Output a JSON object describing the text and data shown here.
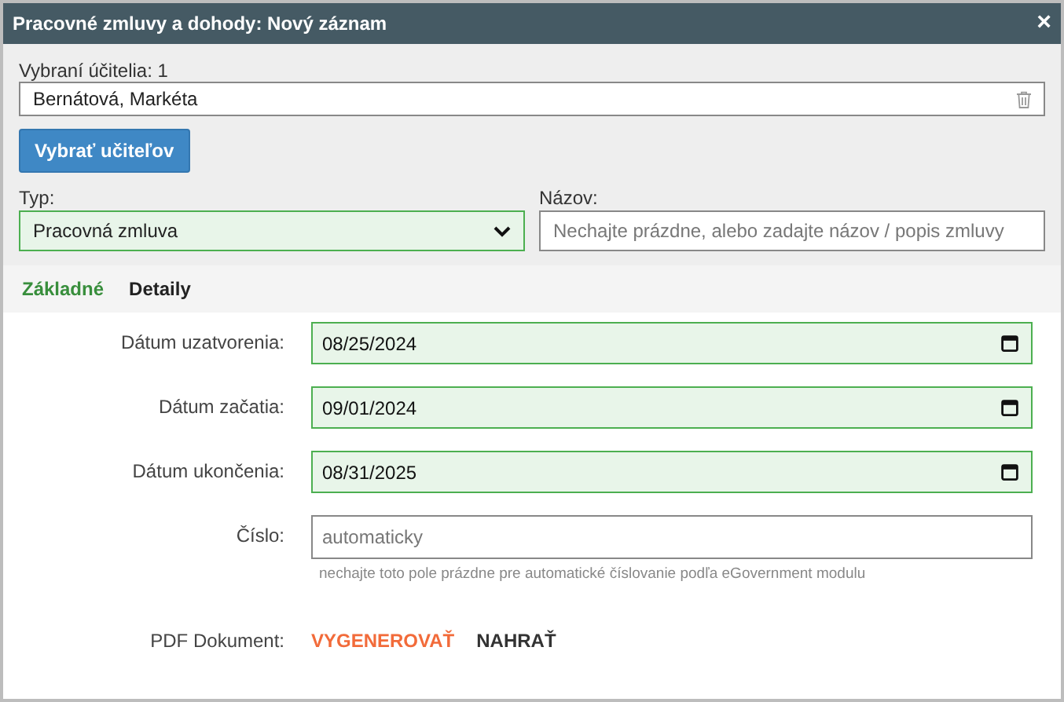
{
  "window": {
    "title": "Pracovné zmluvy a dohody: Nový záznam",
    "close": "×"
  },
  "teachers": {
    "label": "Vybraní účitelia: 1",
    "value": "Bernátová, Markéta"
  },
  "select_button": "Vybrať učiteľov",
  "type": {
    "label": "Typ:",
    "value": "Pracovná zmluva"
  },
  "name": {
    "label": "Názov:",
    "placeholder": "Nechajte prázdne, alebo zadajte názov / popis zmluvy"
  },
  "tabs": [
    {
      "label": "Základné",
      "selected": true
    },
    {
      "label": "Detaily",
      "selected": false
    }
  ],
  "fields": [
    {
      "kind": "date",
      "label": "Dátum uzatvorenia:",
      "value": "08/25/2024"
    },
    {
      "kind": "date",
      "label": "Dátum začatia:",
      "value": "09/01/2024"
    },
    {
      "kind": "date",
      "label": "Dátum ukončenia:",
      "value": "08/31/2025"
    },
    {
      "kind": "text",
      "label": "Číslo:",
      "placeholder": "automaticky",
      "hint": "nechajte toto pole prázdne pre automatické číslovanie podľa eGovernment modulu"
    }
  ],
  "pdf": {
    "label": "PDF Dokument:",
    "actions": [
      {
        "label": "VYGENEROVAŤ",
        "color": "#f26b3a"
      },
      {
        "label": "NAHRAŤ",
        "color": "#333333"
      }
    ]
  }
}
